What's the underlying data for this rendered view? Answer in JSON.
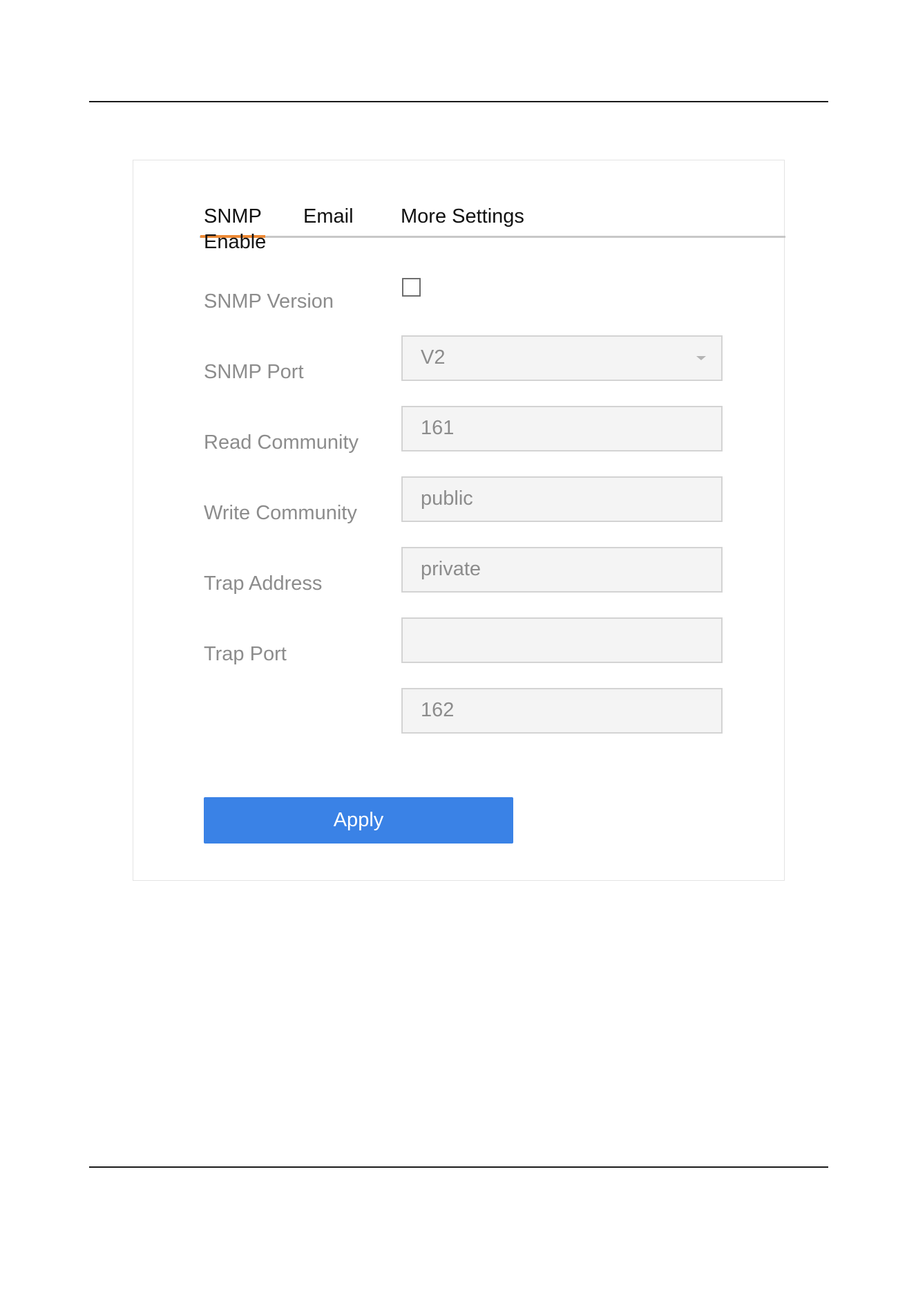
{
  "tabs": [
    {
      "label": "SNMP",
      "active": true
    },
    {
      "label": "Email",
      "active": false
    },
    {
      "label": "More Settings",
      "active": false
    }
  ],
  "form": {
    "enable": {
      "label": "Enable",
      "checked": false
    },
    "snmp_version": {
      "label": "SNMP Version",
      "value": "V2"
    },
    "snmp_port": {
      "label": "SNMP Port",
      "value": "161"
    },
    "read_community": {
      "label": "Read Community",
      "value": "public"
    },
    "write_community": {
      "label": "Write Community",
      "value": "private"
    },
    "trap_address": {
      "label": "Trap Address",
      "value": ""
    },
    "trap_port": {
      "label": "Trap Port",
      "value": "162"
    }
  },
  "actions": {
    "apply_label": "Apply"
  },
  "colors": {
    "accent_tab": "#ee8a35",
    "primary_button": "#3a82e6",
    "input_background": "#f4f4f4",
    "disabled_text": "#8c8c8c"
  },
  "icons": {
    "select_arrow": "chevron-down-icon"
  }
}
